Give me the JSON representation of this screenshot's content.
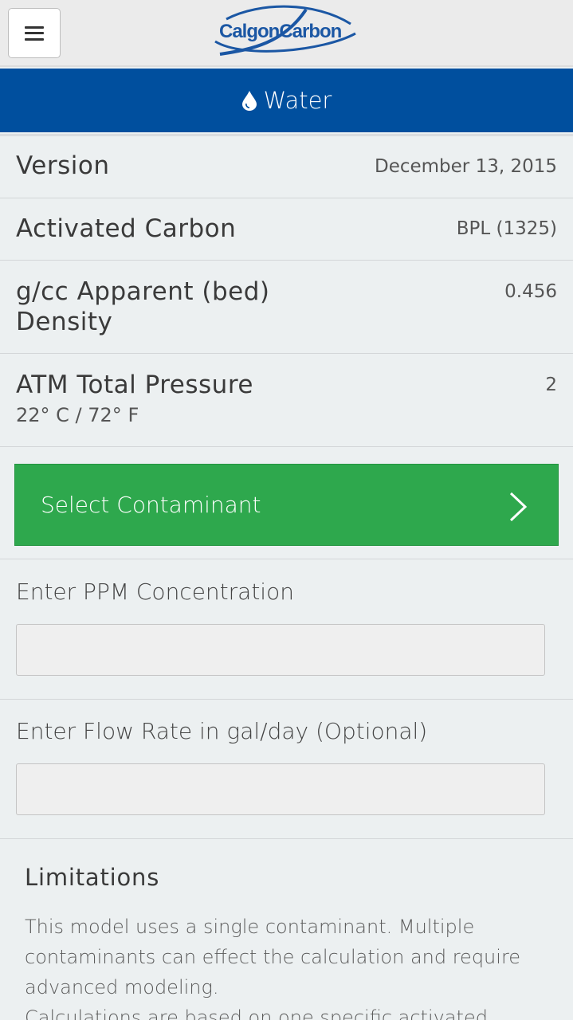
{
  "header": {
    "logo_text": "CalgonCarbon",
    "menu_icon": "hamburger-menu-icon"
  },
  "titlebar": {
    "icon": "water-drop-icon",
    "title": "Water"
  },
  "rows": {
    "version": {
      "label": "Version",
      "value": "December 13, 2015"
    },
    "carbon": {
      "label": "Activated Carbon",
      "value": "BPL (1325)"
    },
    "density": {
      "label_line1": "g/cc Apparent (bed)",
      "label_line2": "Density",
      "value": "0.456"
    },
    "pressure": {
      "label": "ATM Total Pressure",
      "sublabel": "22° C / 72° F",
      "value": "2"
    }
  },
  "select_contaminant": {
    "label": "Select Contaminant",
    "icon": "chevron-right-icon"
  },
  "ppm_field": {
    "label": "Enter PPM Concentration",
    "value": ""
  },
  "flow_field": {
    "label": "Enter Flow Rate in gal/day (Optional)",
    "value": ""
  },
  "limitations": {
    "title": "Limitations",
    "paragraph1": "This model uses a single contaminant. Multiple contaminants can effect the calculation and require advanced modeling.",
    "paragraph2": "Calculations are based on one specific activated"
  },
  "colors": {
    "brand_blue": "#004f9e",
    "action_green": "#2ea84d",
    "background": "#ecf0f1"
  }
}
